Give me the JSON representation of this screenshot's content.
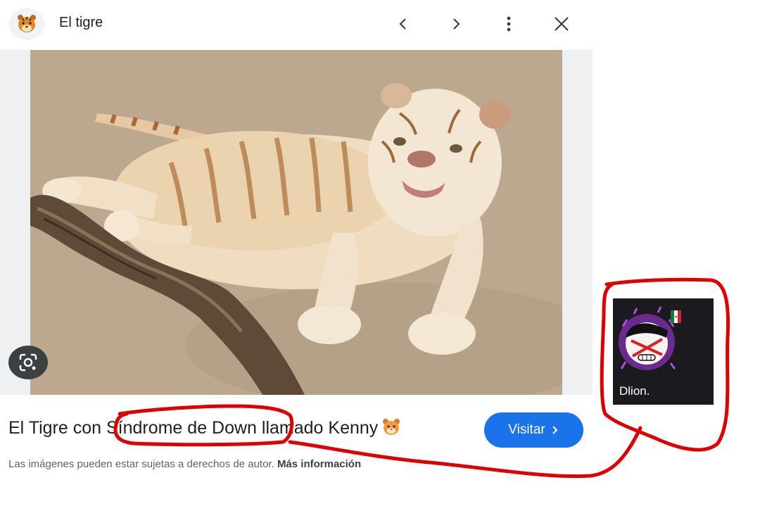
{
  "header": {
    "favicon": "tiger-face-icon",
    "title": "El tigre",
    "prev_icon": "chevron-left-icon",
    "next_icon": "chevron-right-icon",
    "more_icon": "more-vertical-icon",
    "close_icon": "close-icon"
  },
  "image": {
    "subject": "white-tiger-photo",
    "lens_icon": "google-lens-icon"
  },
  "caption": {
    "prefix": "El Tigre con ",
    "highlight": "Síndrome de Down",
    "suffix": " llamado Kenny",
    "emoji": "🐯"
  },
  "visit_button": {
    "label": "Visitar",
    "icon": "chevron-right-icon"
  },
  "notice": {
    "text": "Las imágenes pueden estar sujetas a derechos de autor.",
    "link": "Más información"
  },
  "profile_card": {
    "name": "Dlion.",
    "avatar": "cartoon-avatar-icon",
    "flag": "mexico-flag-icon"
  },
  "colors": {
    "accent": "#1a73e8",
    "annotation": "#e00000",
    "card_bg": "#1b1b1f"
  }
}
